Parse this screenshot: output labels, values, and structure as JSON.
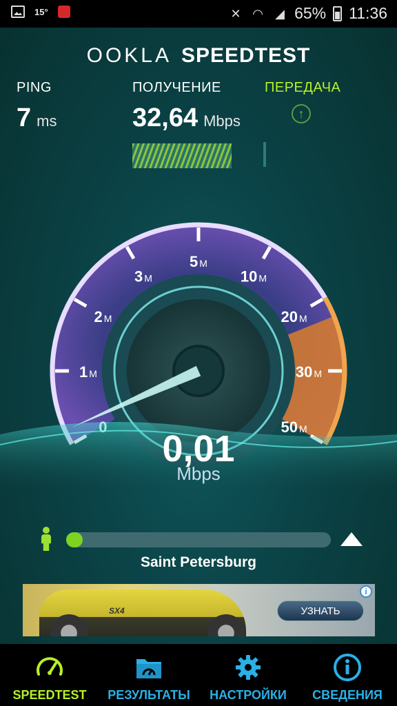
{
  "status_bar": {
    "temperature": "15°",
    "battery": "65%",
    "time": "11:36"
  },
  "header": {
    "logo_ookla": "OOKLA",
    "logo_speedtest": "SPEEDTEST"
  },
  "metrics": {
    "ping_label": "PING",
    "ping_value": "7",
    "ping_unit": "ms",
    "download_label": "ПОЛУЧЕНИЕ",
    "download_value": "32,64",
    "download_unit": "Mbps",
    "upload_label": "ПЕРЕДАЧА"
  },
  "gauge": {
    "ticks": [
      {
        "value": "0",
        "unit": ""
      },
      {
        "value": "1",
        "unit": "M"
      },
      {
        "value": "2",
        "unit": "M"
      },
      {
        "value": "3",
        "unit": "M"
      },
      {
        "value": "5",
        "unit": "M"
      },
      {
        "value": "10",
        "unit": "M"
      },
      {
        "value": "20",
        "unit": "M"
      },
      {
        "value": "30",
        "unit": "M"
      },
      {
        "value": "50",
        "unit": "M"
      }
    ],
    "current_value": "0,01",
    "current_unit": "Mbps",
    "colors": {
      "arc": "#c9b6ff",
      "fill": "#5a3f93",
      "orange": "#e0883a",
      "needle": "#bff4f4"
    }
  },
  "test_progress": {
    "fraction": 0.03,
    "location": "Saint Petersburg"
  },
  "ad": {
    "model_text": "SX4",
    "button_label": "УЗНАТЬ",
    "info_glyph": "i"
  },
  "nav": {
    "items": [
      {
        "label": "SPEEDTEST",
        "icon": "speedometer-icon",
        "active": true
      },
      {
        "label": "РЕЗУЛЬТАТЫ",
        "icon": "folder-icon",
        "active": false
      },
      {
        "label": "НАСТРОЙКИ",
        "icon": "gear-icon",
        "active": false
      },
      {
        "label": "СВЕДЕНИЯ",
        "icon": "info-icon",
        "active": false
      }
    ],
    "colors": {
      "active": "#b6f027",
      "inactive": "#2ab0e6"
    }
  }
}
